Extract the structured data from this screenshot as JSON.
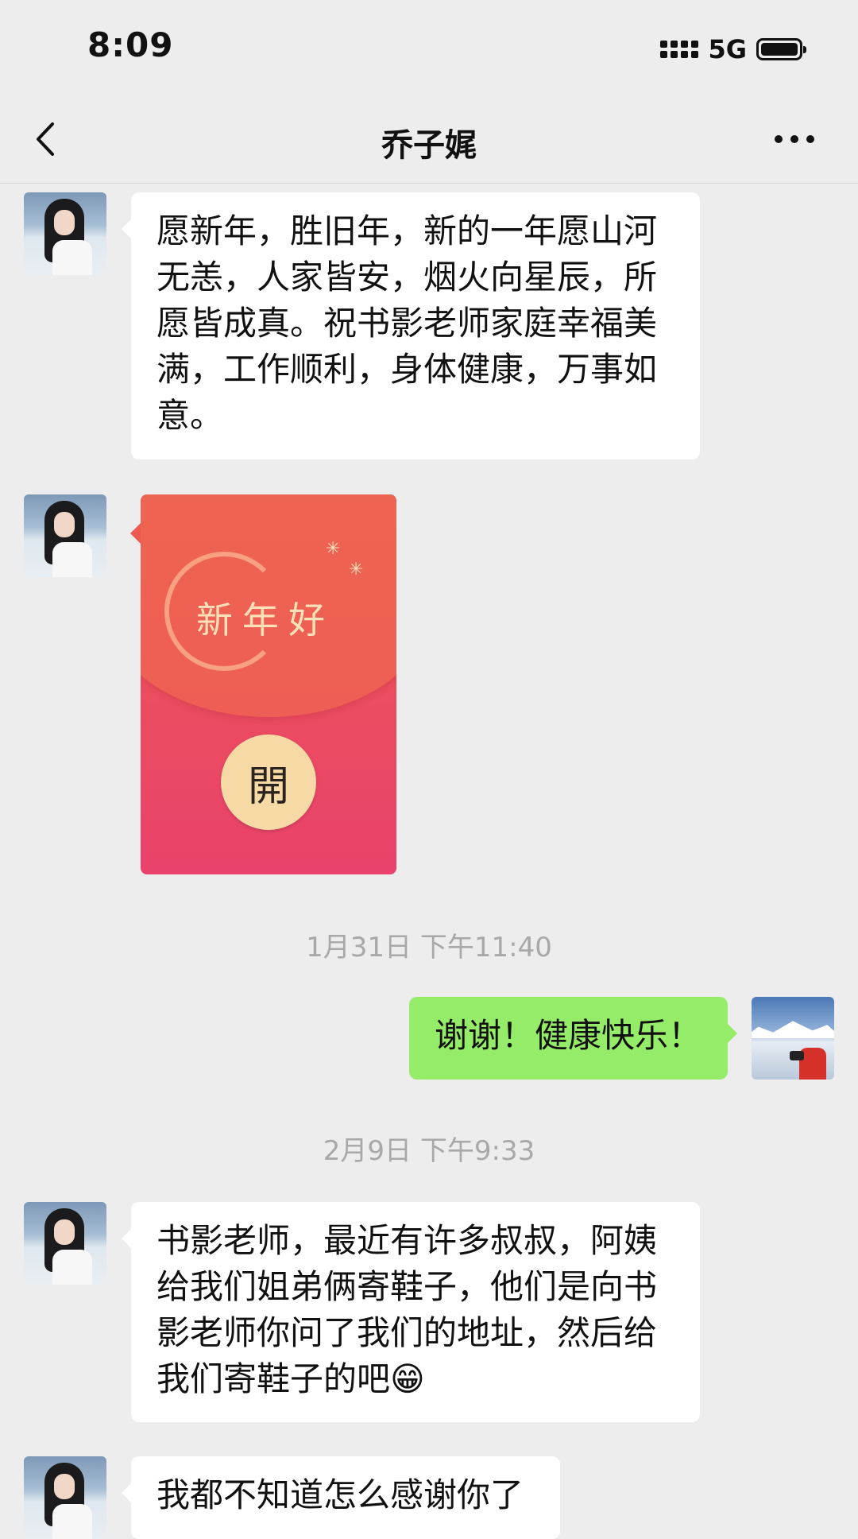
{
  "status_bar": {
    "time": "8:09",
    "network": "5G"
  },
  "nav": {
    "title": "乔子娓"
  },
  "messages": [
    {
      "text": "愿新年，胜旧年，新的一年愿山河无恙，人家皆安，烟火向星辰，所愿皆成真。祝书影老师家庭幸福美满，工作顺利，身体健康，万事如意。"
    },
    {
      "greeting": "新年好",
      "open_label": "開"
    },
    {
      "timestamp": "1月31日 下午11:40"
    },
    {
      "text": "谢谢！健康快乐！"
    },
    {
      "timestamp": "2月9日 下午9:33"
    },
    {
      "text": "书影老师，最近有许多叔叔，阿姨给我们姐弟俩寄鞋子，他们是向书影老师你问了我们的地址，然后给我们寄鞋子的吧😁"
    },
    {
      "text": "我都不知道怎么感谢你了"
    }
  ],
  "icons": {
    "back": "chevron-left-icon",
    "more": "more-dots-icon",
    "signal": "signal-bars-icon",
    "battery": "battery-icon"
  },
  "colors": {
    "background": "#ededed",
    "bubble_incoming": "#ffffff",
    "bubble_outgoing": "#95ec69",
    "red_packet": "#ec4f5d",
    "red_packet_text": "#fbe0b8"
  }
}
